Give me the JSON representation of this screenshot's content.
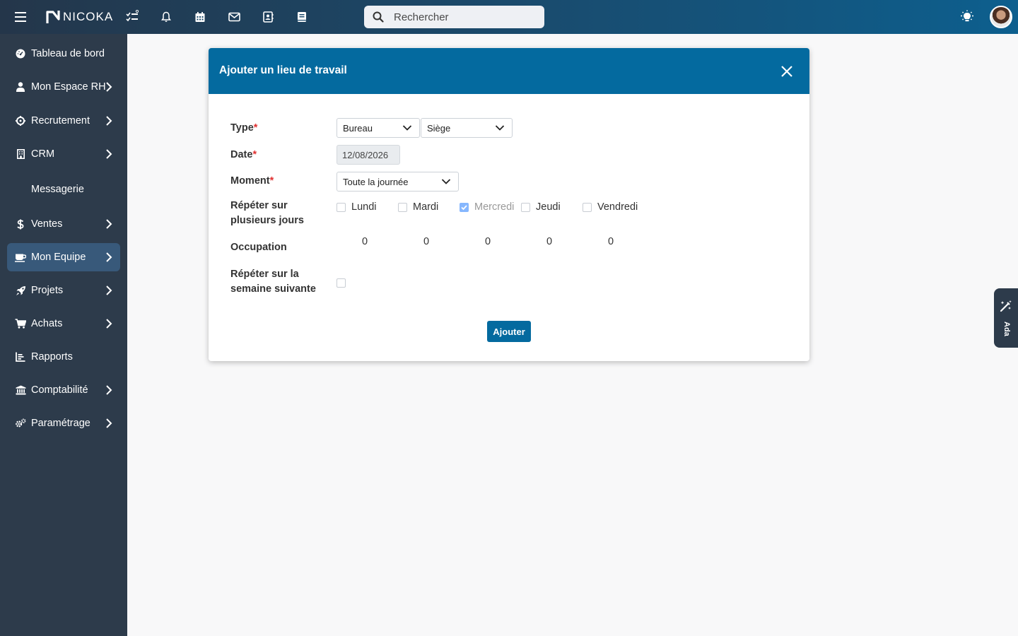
{
  "app": {
    "logo_text": "NICOKA"
  },
  "topbar": {
    "search": {
      "placeholder": "Rechercher"
    },
    "icons": [
      "menu-icon",
      "tasks-icon",
      "bell-icon",
      "calendar-icon",
      "mail-icon",
      "contacts-icon",
      "book-icon",
      "lightbulb-icon"
    ]
  },
  "sidebar": {
    "items": [
      {
        "label": "Tableau de bord",
        "icon": "dashboard-icon",
        "has_submenu": false
      },
      {
        "label": "Mon Espace RH",
        "icon": "user-icon",
        "has_submenu": true
      },
      {
        "label": "Recrutement",
        "icon": "crosshair-icon",
        "has_submenu": true
      },
      {
        "label": "CRM",
        "icon": "building-icon",
        "has_submenu": true
      },
      {
        "label": "Messagerie",
        "icon": "",
        "has_submenu": false
      },
      {
        "label": "Ventes",
        "icon": "dollar-icon",
        "has_submenu": true
      },
      {
        "label": "Mon Equipe",
        "icon": "coffee-icon",
        "has_submenu": true,
        "active": true
      },
      {
        "label": "Projets",
        "icon": "rocket-icon",
        "has_submenu": true
      },
      {
        "label": "Achats",
        "icon": "cart-icon",
        "has_submenu": true
      },
      {
        "label": "Rapports",
        "icon": "report-icon",
        "has_submenu": false
      },
      {
        "label": "Comptabilité",
        "icon": "bank-icon",
        "has_submenu": true
      },
      {
        "label": "Paramétrage",
        "icon": "cogs-icon",
        "has_submenu": true
      }
    ]
  },
  "modal": {
    "title": "Ajouter un lieu de travail",
    "labels": {
      "type": "Type",
      "date": "Date",
      "moment": "Moment",
      "repeat_days_line1": "Répéter sur",
      "repeat_days_line2": "plusieurs jours",
      "occupation": "Occupation",
      "repeat_week_line1": "Répéter sur la",
      "repeat_week_line2": "semaine suivante"
    },
    "required_mark": "*",
    "type_value": "Bureau",
    "location_value": "Siège",
    "date_value": "12/08/2026",
    "moment_value": "Toute la journée",
    "days": [
      {
        "label": "Lundi",
        "checked": false,
        "occupation": "0"
      },
      {
        "label": "Mardi",
        "checked": false,
        "occupation": "0"
      },
      {
        "label": "Mercredi",
        "checked": true,
        "occupation": "0"
      },
      {
        "label": "Jeudi",
        "checked": false,
        "occupation": "0"
      },
      {
        "label": "Vendredi",
        "checked": false,
        "occupation": "0"
      }
    ],
    "repeat_next_week": false,
    "submit_label": "Ajouter"
  },
  "ada": {
    "label": "Ada"
  },
  "colors": {
    "primary": "#046a9f",
    "sidebar": "#2d3b4b",
    "sidebar_active": "#38597a",
    "required": "#e03131"
  }
}
